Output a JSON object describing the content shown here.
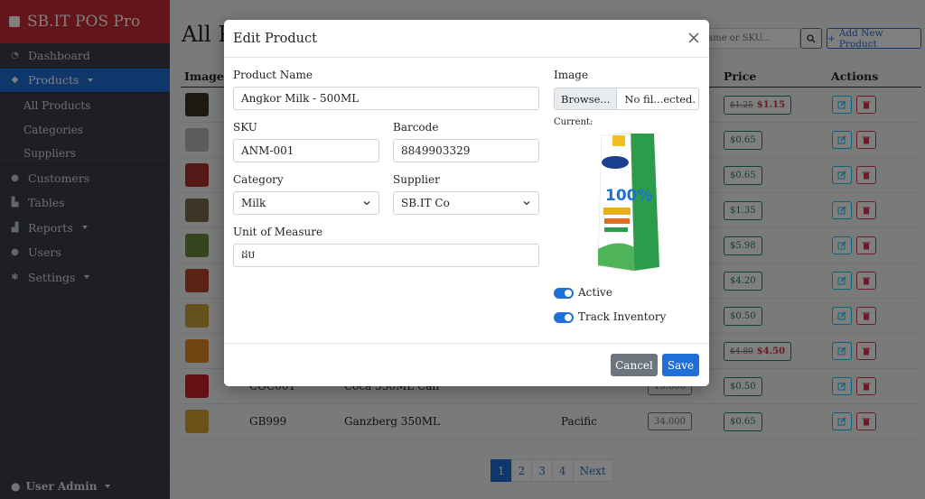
{
  "brand": {
    "title": "SB.IT POS Pro",
    "icon": "cash-register-icon"
  },
  "sidebar": {
    "items": [
      {
        "label": "Dashboard",
        "icon": "dashboard-icon"
      },
      {
        "label": "Products",
        "icon": "box-icon"
      },
      {
        "label": "All Products"
      },
      {
        "label": "Categories"
      },
      {
        "label": "Suppliers"
      },
      {
        "label": "Customers",
        "icon": "users-icon"
      },
      {
        "label": "Tables",
        "icon": "chair-icon"
      },
      {
        "label": "Reports",
        "icon": "chart-icon"
      },
      {
        "label": "Users",
        "icon": "user-icon"
      },
      {
        "label": "Settings",
        "icon": "gears-icon"
      }
    ],
    "user": "User Admin"
  },
  "main": {
    "title": "All P",
    "search_placeholder": "y name or SKU...",
    "add_label": "Add New Product",
    "columns": {
      "image": "Image",
      "price": "Price",
      "actions": "Actions"
    },
    "rows": [
      {
        "price_old": "$1.25",
        "price": "$1.15",
        "thumb": "#3b3320"
      },
      {
        "price": "$0.65",
        "thumb": "#b7b9bd"
      },
      {
        "price": "$0.65",
        "thumb": "#a8332e"
      },
      {
        "price": "$1.35",
        "thumb": "#7a6a4a"
      },
      {
        "price": "$5.98",
        "thumb": "#6b8a3a"
      },
      {
        "price": "$4.20",
        "thumb": "#b8442d"
      },
      {
        "price": "$0.50",
        "thumb": "#c9a23b"
      },
      {
        "price_old": "$4.80",
        "price": "$4.50",
        "thumb": "#e38b24"
      },
      {
        "sku": "COC001",
        "name": "Coca 330ML Can",
        "cost": "15.000",
        "price": "$0.50",
        "thumb": "#c9202b"
      },
      {
        "sku": "GB999",
        "name": "Ganzberg 350ML",
        "supplier": "Pacific",
        "cost": "34.000",
        "price": "$0.65",
        "thumb": "#d7a22e"
      }
    ],
    "pagination": [
      "1",
      "2",
      "3",
      "4",
      "Next"
    ]
  },
  "modal": {
    "title": "Edit Product",
    "product_name_label": "Product Name",
    "product_name": "Angkor Milk - 500ML",
    "sku_label": "SKU",
    "sku": "ANM-001",
    "barcode_label": "Barcode",
    "barcode": "8849903329",
    "category_label": "Category",
    "category": "Milk",
    "supplier_label": "Supplier",
    "supplier": "SB.IT Co",
    "uom_label": "Unit of Measure",
    "uom": "ដប",
    "image_label": "Image",
    "browse_label": "Browse...",
    "file_name": "No fil...ected.",
    "current_label": "Current:",
    "image_text": "100%",
    "active_label": "Active",
    "track_label": "Track Inventory",
    "cancel_label": "Cancel",
    "save_label": "Save"
  },
  "colors": {
    "brand": "#c62a34",
    "accent": "#1f6fd8",
    "sidebar": "#3a3f44"
  }
}
